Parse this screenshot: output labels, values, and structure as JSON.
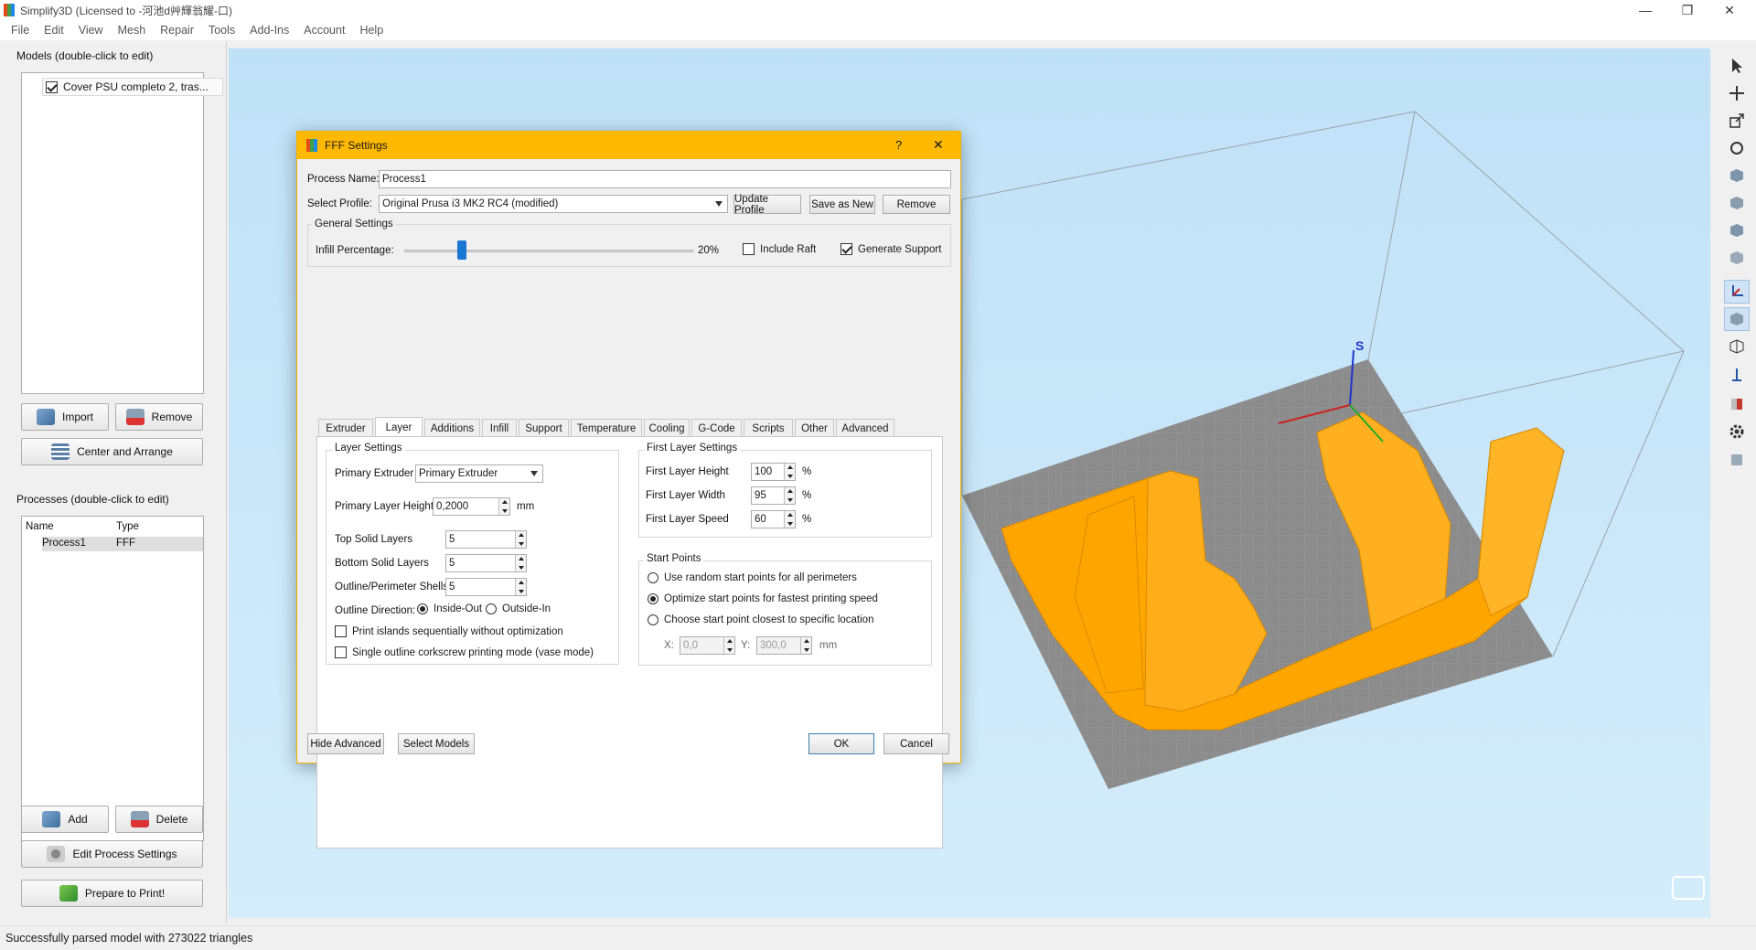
{
  "window": {
    "title": "Simplify3D (Licensed to -河池d艸輝翁耀-口)",
    "minimize": "—",
    "maximize": "❐",
    "close": "✕"
  },
  "menu": [
    "File",
    "Edit",
    "View",
    "Mesh",
    "Repair",
    "Tools",
    "Add-Ins",
    "Account",
    "Help"
  ],
  "models_panel": {
    "title": "Models (double-click to edit)",
    "items": [
      {
        "label": "Cover PSU completo 2, tras...",
        "checked": true
      }
    ],
    "import_label": "Import",
    "remove_label": "Remove",
    "center_label": "Center and Arrange"
  },
  "processes_panel": {
    "title": "Processes (double-click to edit)",
    "col_name": "Name",
    "col_type": "Type",
    "rows": [
      {
        "name": "Process1",
        "type": "FFF"
      }
    ],
    "add_label": "Add",
    "delete_label": "Delete",
    "edit_label": "Edit Process Settings",
    "prepare_label": "Prepare to Print!"
  },
  "status": "Successfully parsed model with 273022 triangles",
  "viewport": {
    "axis_z_label": "S",
    "bg_top": "#bfe1f7",
    "bed_color": "#8c8c8c",
    "model_color": "#ffa500"
  },
  "dialog": {
    "title": "FFF Settings",
    "help": "?",
    "close": "✕",
    "process_name_label": "Process Name:",
    "process_name_value": "Process1",
    "select_profile_label": "Select Profile:",
    "profile_value": "Original Prusa i3 MK2 RC4 (modified)",
    "update_profile": "Update Profile",
    "save_as_new": "Save as New",
    "remove": "Remove",
    "general_settings": "General Settings",
    "infill_label": "Infill Percentage:",
    "infill_value_text": "20%",
    "infill_percent": 20,
    "include_raft": "Include Raft",
    "include_raft_checked": false,
    "generate_support": "Generate Support",
    "generate_support_checked": true,
    "tabs": [
      "Extruder",
      "Layer",
      "Additions",
      "Infill",
      "Support",
      "Temperature",
      "Cooling",
      "G-Code",
      "Scripts",
      "Other",
      "Advanced"
    ],
    "active_tab": "Layer",
    "layer_settings": {
      "title": "Layer Settings",
      "primary_extruder_label": "Primary Extruder",
      "primary_extruder_value": "Primary Extruder",
      "primary_layer_height_label": "Primary Layer Height",
      "primary_layer_height_value": "0,2000",
      "mm": "mm",
      "top_solid_label": "Top Solid Layers",
      "top_solid_value": "5",
      "bottom_solid_label": "Bottom Solid Layers",
      "bottom_solid_value": "5",
      "outline_shells_label": "Outline/Perimeter Shells",
      "outline_shells_value": "5",
      "outline_direction_label": "Outline Direction:",
      "inside_out": "Inside-Out",
      "outside_in": "Outside-In",
      "print_islands": "Print islands sequentially without optimization",
      "single_outline": "Single outline corkscrew printing mode (vase mode)"
    },
    "first_layer": {
      "title": "First Layer Settings",
      "height_label": "First Layer Height",
      "height_value": "100",
      "width_label": "First Layer Width",
      "width_value": "95",
      "speed_label": "First Layer Speed",
      "speed_value": "60",
      "pct": "%"
    },
    "start_points": {
      "title": "Start Points",
      "opt1": "Use random start points for all perimeters",
      "opt2": "Optimize start points for fastest printing speed",
      "opt3": "Choose start point closest to specific location",
      "selected": 2,
      "x_label": "X:",
      "x_value": "0,0",
      "y_label": "Y:",
      "y_value": "300,0",
      "mm": "mm"
    },
    "hide_advanced": "Hide Advanced",
    "select_models": "Select Models",
    "ok": "OK",
    "cancel": "Cancel"
  },
  "toolbar_icons": [
    "select-arrow-icon",
    "move-icon",
    "scale-icon",
    "rotate-icon",
    "view-default-icon",
    "view-front-icon",
    "view-side-icon",
    "view-top-icon",
    "axes-icon",
    "solid-view-icon",
    "wireframe-icon",
    "cross-section-icon",
    "build-table-icon",
    "settings-gear-icon",
    "bin-icon"
  ]
}
